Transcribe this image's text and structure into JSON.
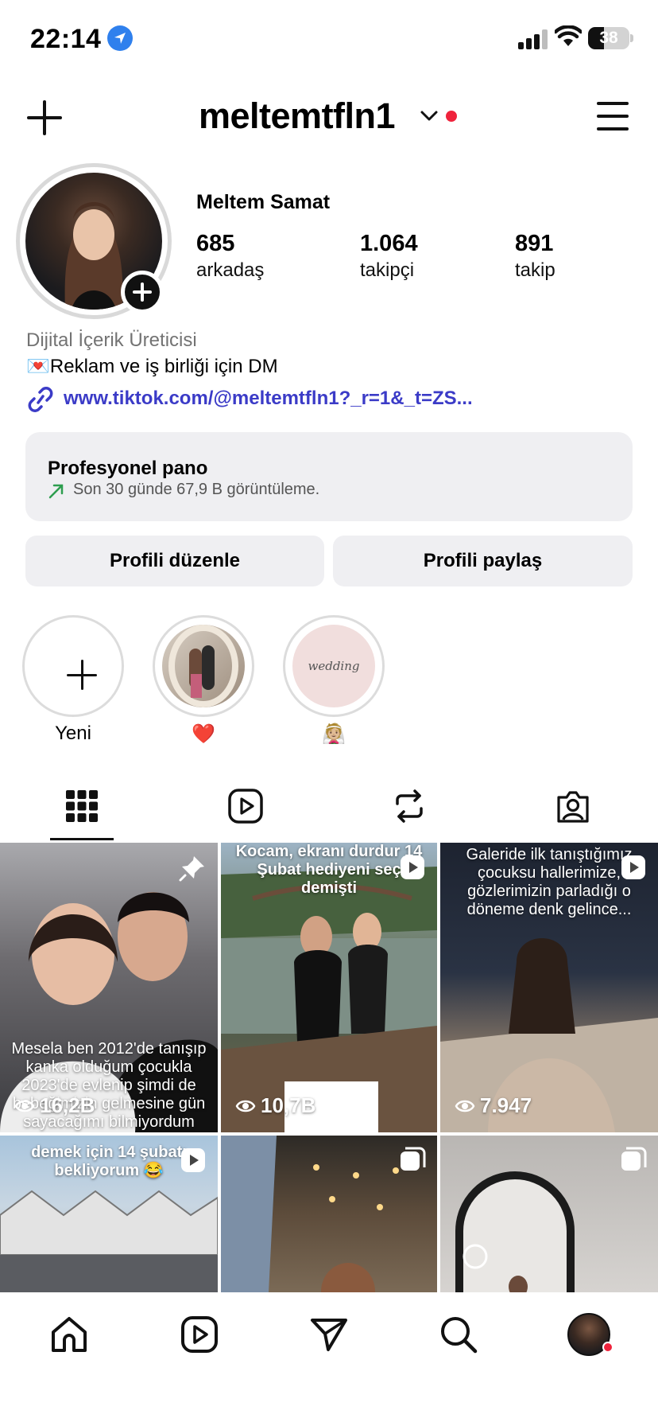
{
  "status_bar": {
    "time": "22:14",
    "battery": "38"
  },
  "header": {
    "username": "meltemtfln1"
  },
  "profile": {
    "full_name": "Meltem Samat",
    "stats": [
      {
        "value": "685",
        "label": "arkadaş"
      },
      {
        "value": "1.064",
        "label": "takipçi"
      },
      {
        "value": "891",
        "label": "takip"
      }
    ],
    "category": "Dijital İçerik Üreticisi",
    "bio": "💌Reklam ve iş birliği için DM",
    "link": "www.tiktok.com/@meltemtfln1?_r=1&_t=ZS..."
  },
  "dashboard": {
    "title": "Profesyonel pano",
    "subtitle": "Son 30 günde 67,9 B görüntüleme."
  },
  "buttons": {
    "edit": "Profili düzenle",
    "share": "Profili paylaş"
  },
  "highlights": [
    {
      "label": "Yeni"
    },
    {
      "label": "❤️"
    },
    {
      "label": "👰🏼",
      "cover_text": "wedding"
    }
  ],
  "grid": [
    {
      "views": "16,2B",
      "caption": "Mesela ben 2012'de tanışıp kanka olduğum çocukla 2023'de evlenip şimdi de bebeğimizin gelmesine gün sayacağımı bilmiyordum"
    },
    {
      "views": "10,7B",
      "caption": "Kocam, ekranı durdur 14 Şubat hediyeni seç demişti"
    },
    {
      "views": "7.947",
      "caption": "Galeride ilk tanıştığımız çocuksu hallerimize, gözlerimizin parladığı o döneme denk gelince..."
    },
    {
      "caption": "demek için 14 şubatı bekliyorum 😂"
    },
    {},
    {}
  ],
  "colors": {
    "accent_red": "#ef233c",
    "link_blue": "#3b3bc7",
    "location_blue": "#2f80ed"
  }
}
